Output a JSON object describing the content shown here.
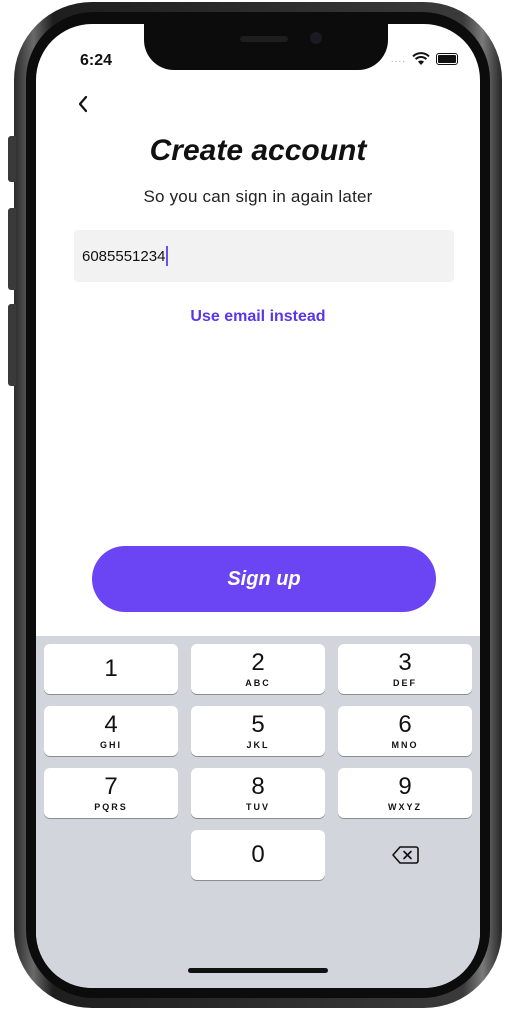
{
  "status_bar": {
    "time": "6:24",
    "signal_dots": "...."
  },
  "header": {
    "title": "Create account",
    "subtitle": "So you can sign in again later"
  },
  "phone_field": {
    "value": "6085551234"
  },
  "email_link": {
    "label": "Use email instead"
  },
  "signup_button": {
    "label": "Sign up"
  },
  "keypad": {
    "keys": [
      {
        "digit": "1",
        "letters": ""
      },
      {
        "digit": "2",
        "letters": "ABC"
      },
      {
        "digit": "3",
        "letters": "DEF"
      },
      {
        "digit": "4",
        "letters": "GHI"
      },
      {
        "digit": "5",
        "letters": "JKL"
      },
      {
        "digit": "6",
        "letters": "MNO"
      },
      {
        "digit": "7",
        "letters": "PQRS"
      },
      {
        "digit": "8",
        "letters": "TUV"
      },
      {
        "digit": "9",
        "letters": "WXYZ"
      },
      {
        "digit": "0",
        "letters": ""
      }
    ],
    "delete_icon": "backspace-icon"
  },
  "colors": {
    "accent": "#6b45f3",
    "link": "#5b36e8",
    "keyboard_bg": "#d2d5db",
    "field_bg": "#f2f2f2"
  }
}
